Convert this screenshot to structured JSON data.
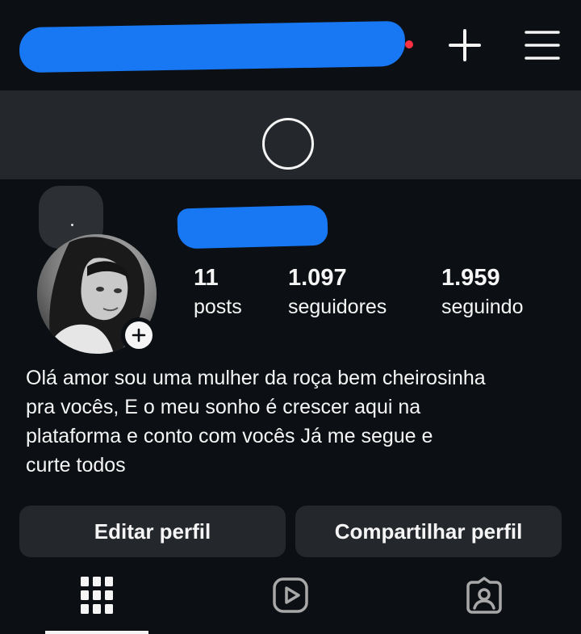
{
  "header": {
    "username_redacted": true,
    "has_notification_dot": true,
    "icons": [
      "plus-icon",
      "hamburger-menu-icon"
    ]
  },
  "profile": {
    "name_redacted": true,
    "stats": [
      {
        "value": "11",
        "label": "posts"
      },
      {
        "value": "1.097",
        "label": "seguidores"
      },
      {
        "value": "1.959",
        "label": "seguindo"
      }
    ],
    "bio": "Olá amor sou uma mulher da roça bem cheirosinha\npra vocês, E o meu sonho é crescer aqui na\nplataforma e conto com vocês Já me segue e\ncurte todos"
  },
  "buttons": {
    "edit": "Editar perfil",
    "share": "Compartilhar perfil"
  },
  "tabs": [
    {
      "icon": "grid-icon",
      "selected": true
    },
    {
      "icon": "reels-icon",
      "selected": false
    },
    {
      "icon": "tagged-icon",
      "selected": false
    }
  ],
  "colors": {
    "background": "#0c1014",
    "surface": "#24282d",
    "redaction": "#1877f2",
    "notification": "#ff3040",
    "text": "#f5f5f5"
  }
}
